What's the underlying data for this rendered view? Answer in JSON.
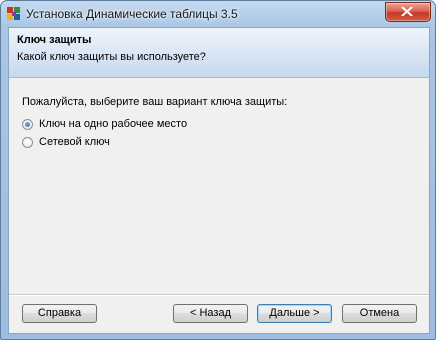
{
  "window": {
    "title": "Установка Динамические таблицы 3.5",
    "close_glyph": "✕"
  },
  "header": {
    "title": "Ключ защиты",
    "subtitle": "Какой ключ защиты вы используете?"
  },
  "content": {
    "prompt": "Пожалуйста, выберите ваш вариант ключа защиты:",
    "options": [
      {
        "label": "Ключ на одно рабочее место",
        "selected": true
      },
      {
        "label": "Сетевой ключ",
        "selected": false
      }
    ]
  },
  "buttons": {
    "help": "Справка",
    "back": "< Назад",
    "next": "Дальше >",
    "cancel": "Отмена"
  },
  "colors": {
    "accent": "#3c7fb1",
    "close": "#c0392b",
    "title_bar": "#a9c6e4"
  }
}
